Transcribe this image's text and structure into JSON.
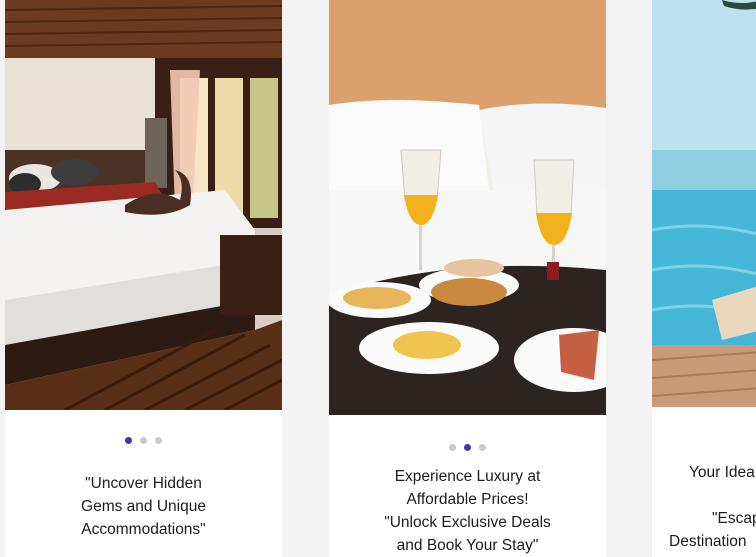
{
  "colors": {
    "active_dot": "#4b2fb0",
    "inactive_dot": "#c9c9cc",
    "card_bg": "#ffffff",
    "page_bg": "#f3f3f4"
  },
  "cards": [
    {
      "image": "bedroom-wooden-interior-photo",
      "dots": {
        "count": 3,
        "active": 0
      },
      "caption": {
        "lines": [
          "\"Uncover Hidden",
          "Gems and Unique",
          "Accommodations\""
        ]
      }
    },
    {
      "image": "breakfast-in-bed-photo",
      "dots": {
        "count": 3,
        "active": 1
      },
      "caption": {
        "lines": [
          "Experience Luxury at",
          "Affordable Prices!",
          "\"Unlock Exclusive Deals",
          "and Book Your Stay\""
        ]
      }
    },
    {
      "image": "infinity-pool-ocean-photo",
      "dots": {
        "count": 3,
        "active": null
      },
      "caption": {
        "lines": [
          "Your Idea",
          "",
          "\"Escap",
          "Destination"
        ]
      }
    }
  ]
}
